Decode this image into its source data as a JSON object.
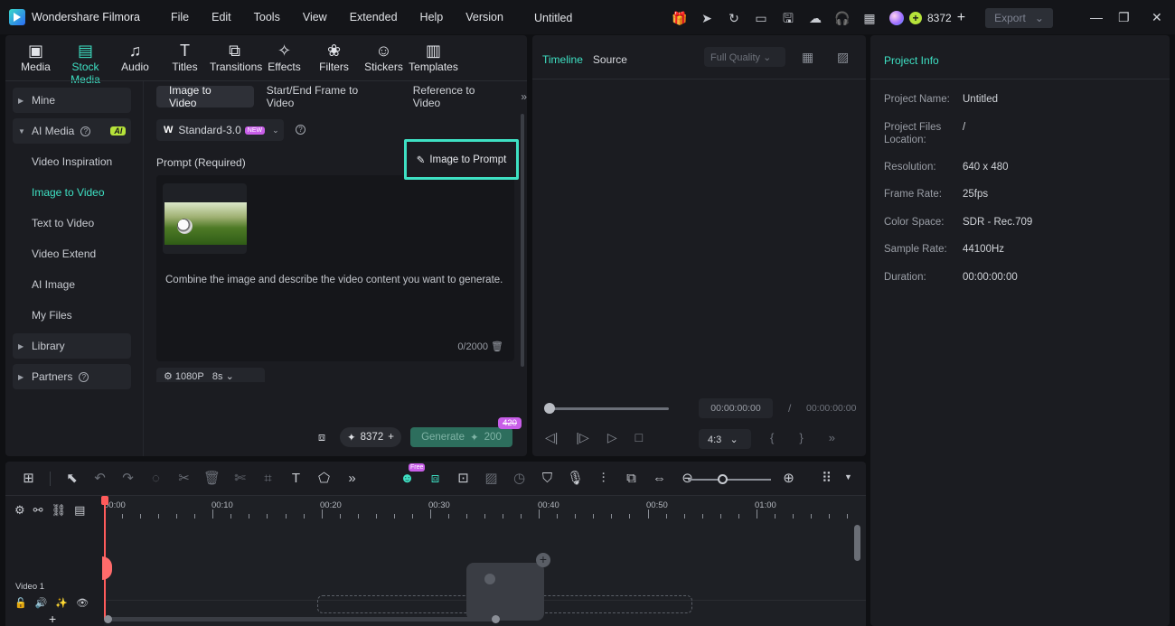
{
  "app": {
    "name": "Wondershare Filmora",
    "doc_title": "Untitled"
  },
  "menu": [
    "File",
    "Edit",
    "Tools",
    "View",
    "Extended",
    "Help",
    "Version"
  ],
  "account": {
    "credits": "8372",
    "export_label": "Export"
  },
  "toolbar": [
    {
      "label": "Media",
      "icon": "media-icon"
    },
    {
      "label": "Stock Media",
      "icon": "stock-media-icon",
      "active": true
    },
    {
      "label": "Audio",
      "icon": "audio-icon"
    },
    {
      "label": "Titles",
      "icon": "titles-icon"
    },
    {
      "label": "Transitions",
      "icon": "transitions-icon"
    },
    {
      "label": "Effects",
      "icon": "effects-icon"
    },
    {
      "label": "Filters",
      "icon": "filters-icon"
    },
    {
      "label": "Stickers",
      "icon": "stickers-icon"
    },
    {
      "label": "Templates",
      "icon": "templates-icon"
    }
  ],
  "nav": {
    "mine": "Mine",
    "ai_media": "AI Media",
    "ai_badge": "AI",
    "sub": [
      "Video Inspiration",
      "Image to Video",
      "Text to Video",
      "Video Extend",
      "AI Image",
      "My Files"
    ],
    "library": "Library",
    "partners": "Partners"
  },
  "subtabs": [
    "Image to Video",
    "Start/End Frame to Video",
    "Reference to Video"
  ],
  "model": {
    "name": "Standard-3.0",
    "badge": "NEW"
  },
  "prompt": {
    "label": "Prompt (Required)",
    "image_to_prompt": "Image to Prompt",
    "hint": "Combine the image and describe the video content you want to generate.",
    "count": "0/2000"
  },
  "settings": {
    "resolution": "1080P",
    "duration": "8s"
  },
  "generate": {
    "credits": "8372",
    "label": "Generate",
    "cost": "200",
    "old_cost": "420"
  },
  "preview": {
    "tab_timeline": "Timeline",
    "tab_source": "Source",
    "quality": "Full Quality",
    "time_current": "00:00:00:00",
    "time_total": "00:00:00:00",
    "ratio": "4:3"
  },
  "info": {
    "title": "Project Info",
    "rows": [
      {
        "k": "Project Name:",
        "v": "Untitled"
      },
      {
        "k": "Project Files Location:",
        "v": "/"
      },
      {
        "k": "Resolution:",
        "v": "640 x 480"
      },
      {
        "k": "Frame Rate:",
        "v": "25fps"
      },
      {
        "k": "Color Space:",
        "v": "SDR - Rec.709"
      },
      {
        "k": "Sample Rate:",
        "v": "44100Hz"
      },
      {
        "k": "Duration:",
        "v": "00:00:00:00"
      }
    ]
  },
  "timeline": {
    "ruler": [
      "00:00",
      "00:10",
      "00:20",
      "00:30",
      "00:40",
      "00:50",
      "01:00"
    ],
    "track_label": "Video 1",
    "free_badge": "Free"
  }
}
